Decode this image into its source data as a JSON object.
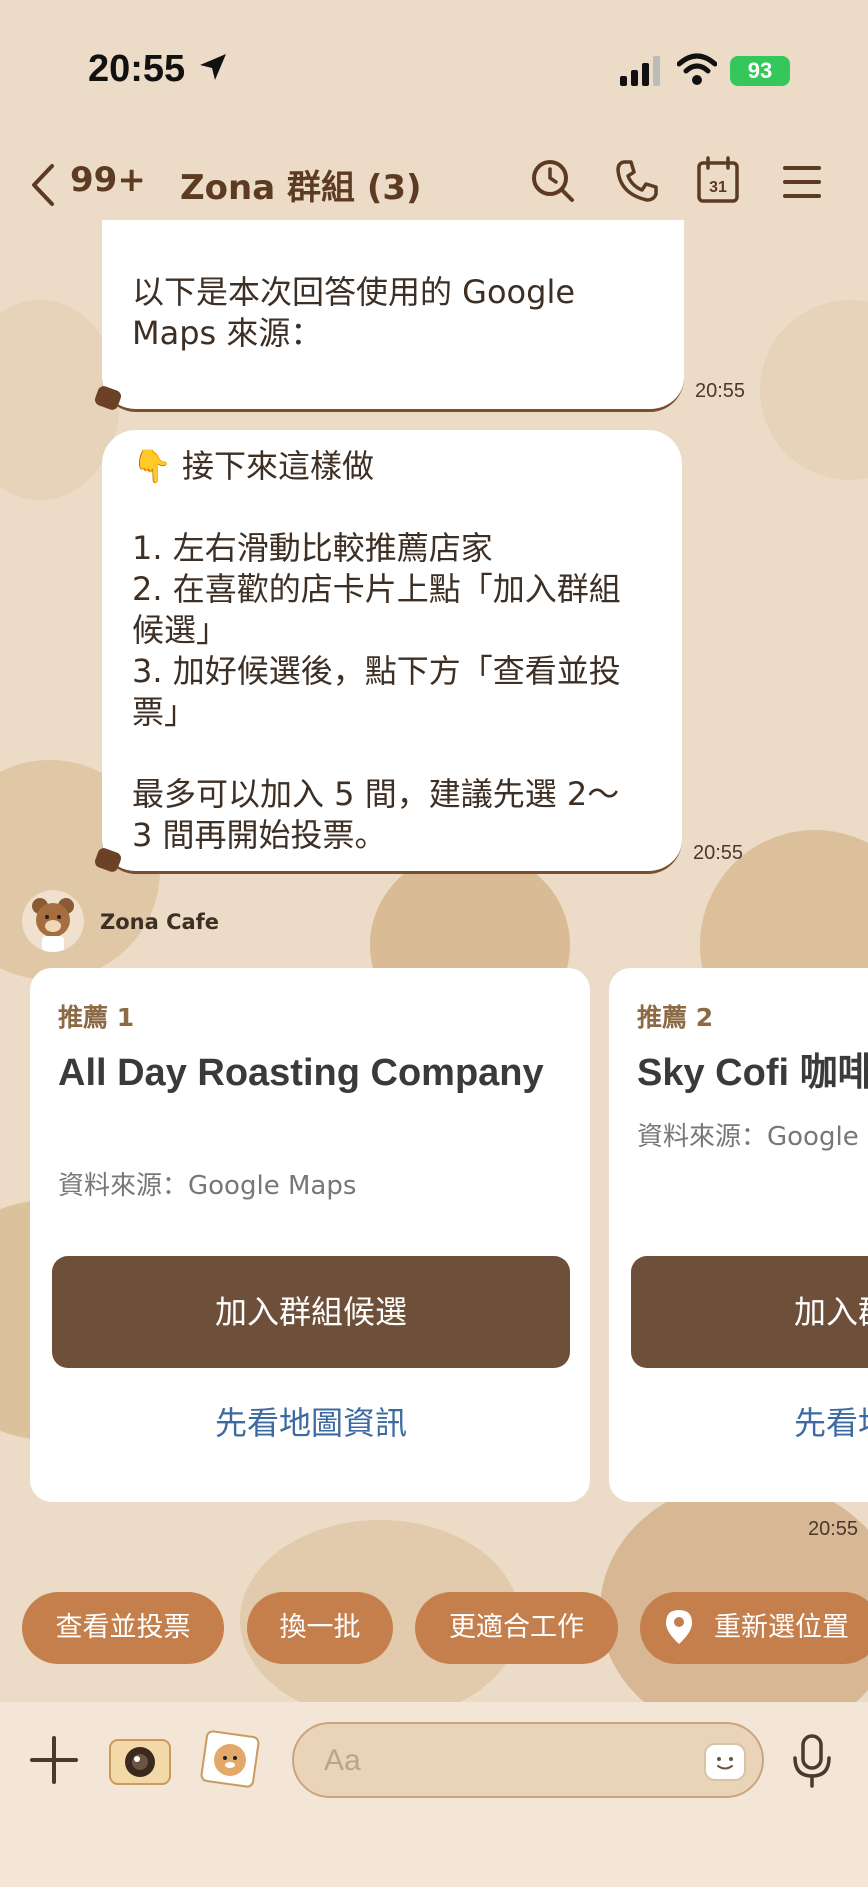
{
  "status_bar": {
    "time": "20:55",
    "battery": "93"
  },
  "header": {
    "back_count": "99+",
    "title": "Zona 群組 (3)",
    "icons": [
      "search-icon",
      "phone-icon",
      "calendar-icon",
      "menu-icon"
    ],
    "calendar_day": "31"
  },
  "messages": [
    {
      "text": "以下是本次回答使用的 Google\nMaps 來源：",
      "time": "20:55"
    },
    {
      "text": "👇 接下來這樣做\n\n1. 左右滑動比較推薦店家\n2. 在喜歡的店卡片上點「加入群組\n候選」\n3. 加好候選後，點下方「查看並投\n票」\n\n最多可以加入 5 間，建議先選 2～\n3 間再開始投票。",
      "time": "20:55"
    }
  ],
  "sender": {
    "name": "Zona Cafe"
  },
  "cards": [
    {
      "tag": "推薦 1",
      "title": "All Day Roasting Company",
      "source": "資料來源：Google Maps",
      "add_label": "加入群組候選",
      "map_label": "先看地圖資訊"
    },
    {
      "tag": "推薦 2",
      "title": "Sky Cofi 咖啡",
      "source": "資料來源：Google Maps",
      "add_label": "加入群組候選",
      "map_label": "先看地圖資訊"
    }
  ],
  "cards_time": "20:55",
  "quick_replies": [
    "查看並投票",
    "換一批",
    "更適合工作",
    "重新選位置"
  ],
  "input": {
    "placeholder": "Aa"
  },
  "colors": {
    "background": "#ecdcc7",
    "brown_button": "#6e4f3a",
    "chip": "#c47f4d",
    "link": "#3d6aa0"
  }
}
